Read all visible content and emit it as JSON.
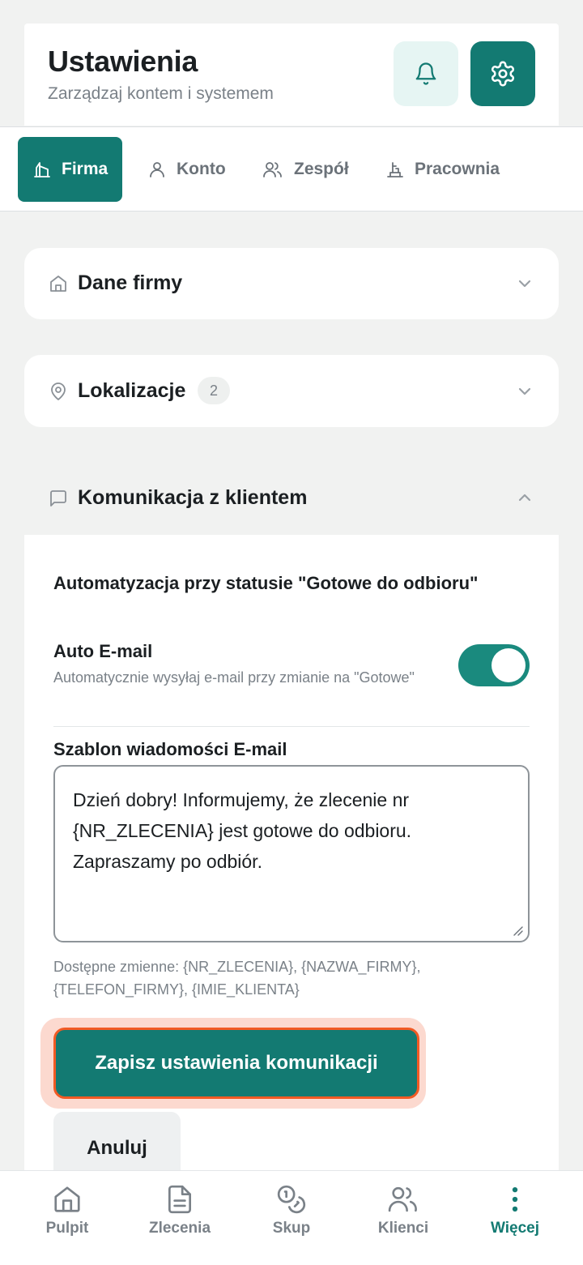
{
  "header": {
    "title": "Ustawienia",
    "subtitle": "Zarządzaj kontem i systemem"
  },
  "tabs": [
    {
      "label": "Firma",
      "icon": "building-icon",
      "active": true
    },
    {
      "label": "Konto",
      "icon": "user-icon",
      "active": false
    },
    {
      "label": "Zespół",
      "icon": "users-icon",
      "active": false
    },
    {
      "label": "Pracownia",
      "icon": "workshop-icon",
      "active": false
    }
  ],
  "sections": {
    "company": {
      "title": "Dane firmy",
      "icon": "home-icon"
    },
    "locations": {
      "title": "Lokalizacje",
      "count": "2",
      "icon": "map-pin-icon"
    },
    "communication": {
      "title": "Komunikacja z klientem",
      "icon": "message-icon"
    }
  },
  "communication": {
    "automation_heading": "Automatyzacja przy statusie \"Gotowe do odbioru\"",
    "auto_email_label": "Auto E-mail",
    "auto_email_desc": "Automatycznie wysyłaj e-mail przy zmianie na \"Gotowe\"",
    "auto_email_enabled": true,
    "template_label": "Szablon wiadomości E-mail",
    "template_value": "Dzień dobry! Informujemy, że zlecenie nr {NR_ZLECENIA} jest gotowe do odbioru. Zapraszamy po odbiór.",
    "variables_hint": "Dostępne zmienne: {NR_ZLECENIA}, {NAZWA_FIRMY}, {TELEFON_FIRMY}, {IMIE_KLIENTA}",
    "save_label": "Zapisz ustawienia komunikacji",
    "cancel_label": "Anuluj"
  },
  "bottom_nav": [
    {
      "label": "Pulpit",
      "icon": "home-icon",
      "active": false
    },
    {
      "label": "Zlecenia",
      "icon": "document-icon",
      "active": false
    },
    {
      "label": "Skup",
      "icon": "coins-icon",
      "active": false
    },
    {
      "label": "Klienci",
      "icon": "users-icon",
      "active": false
    },
    {
      "label": "Więcej",
      "icon": "more-vertical-icon",
      "active": true
    }
  ],
  "colors": {
    "primary": "#137a72",
    "highlight": "#f15a24",
    "background": "#f1f2f1"
  }
}
